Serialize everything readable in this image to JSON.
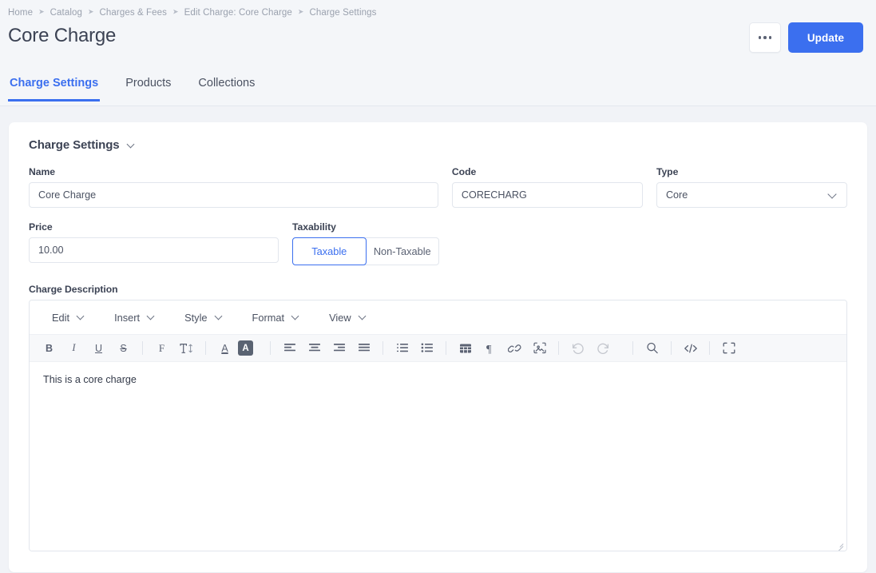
{
  "breadcrumb": {
    "separator": "➤",
    "items": [
      {
        "label": "Home"
      },
      {
        "label": "Catalog"
      },
      {
        "label": "Charges & Fees"
      },
      {
        "label": "Edit Charge: Core Charge"
      },
      {
        "label": "Charge Settings"
      }
    ]
  },
  "header": {
    "title": "Core Charge",
    "more_actions_label": "•••",
    "update_label": "Update",
    "accent_color": "#3b6fef"
  },
  "tabs": [
    {
      "label": "Charge Settings",
      "active": true
    },
    {
      "label": "Products",
      "active": false
    },
    {
      "label": "Collections",
      "active": false
    }
  ],
  "section": {
    "title": "Charge Settings",
    "collapse_icon": "chevron-down"
  },
  "form": {
    "name": {
      "label": "Name",
      "value": "Core Charge",
      "placeholder": "Name"
    },
    "code": {
      "label": "Code",
      "value": "CORECHARG",
      "placeholder": "Code"
    },
    "type": {
      "label": "Type",
      "value": "Core",
      "options": [
        "Core"
      ]
    },
    "price": {
      "label": "Price",
      "value": "10.00",
      "placeholder": "Price"
    },
    "taxability": {
      "label": "Taxability",
      "options": [
        {
          "label": "Taxable",
          "selected": true
        },
        {
          "label": "Non-Taxable",
          "selected": false
        }
      ]
    }
  },
  "editor": {
    "label": "Charge Description",
    "menus": [
      {
        "label": "Edit"
      },
      {
        "label": "Insert"
      },
      {
        "label": "Style"
      },
      {
        "label": "Format"
      },
      {
        "label": "View"
      }
    ],
    "toolbar": {
      "bold": "B",
      "italic": "I",
      "underline": "U",
      "strikethrough": "S",
      "font_family": "F",
      "font_size": "T",
      "text_color": "A",
      "highlight": "A"
    },
    "content": "This is a core charge"
  }
}
